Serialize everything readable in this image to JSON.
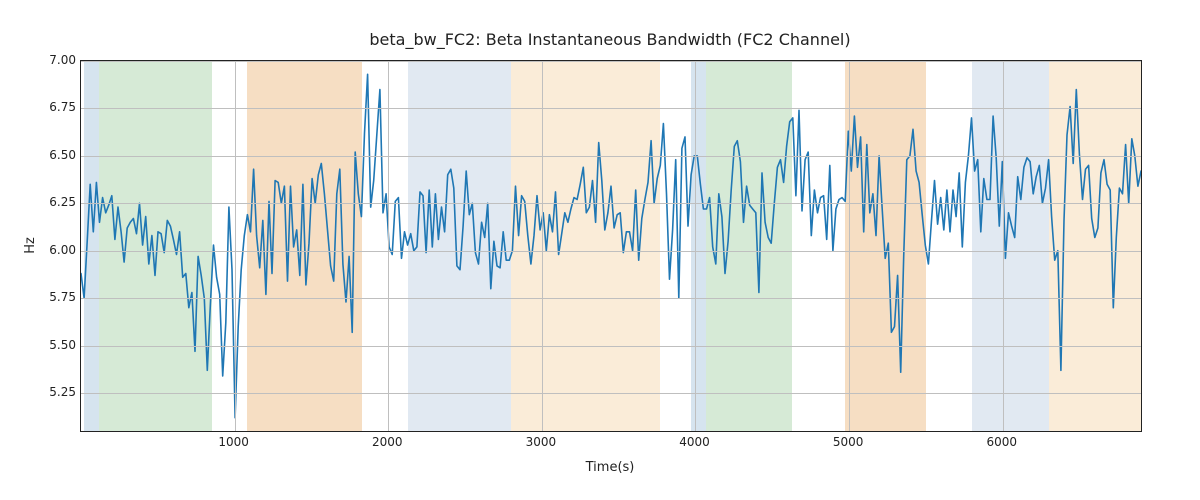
{
  "chart_data": {
    "type": "line",
    "title": "beta_bw_FC2: Beta Instantaneous Bandwidth (FC2 Channel)",
    "xlabel": "Time(s)",
    "ylabel": "Hz",
    "xlim": [
      0,
      6900
    ],
    "ylim": [
      5.05,
      7.0
    ],
    "xticks": [
      1000,
      2000,
      3000,
      4000,
      5000,
      6000
    ],
    "yticks": [
      5.25,
      5.5,
      5.75,
      6.0,
      6.25,
      6.5,
      6.75,
      7.0
    ],
    "spans": [
      {
        "x0": 20,
        "x1": 120,
        "color": "#d6e4ef"
      },
      {
        "x0": 120,
        "x1": 850,
        "color": "#d6ead6"
      },
      {
        "x0": 1080,
        "x1": 1830,
        "color": "#f6dec3"
      },
      {
        "x0": 2130,
        "x1": 2800,
        "color": "#e1e9f2"
      },
      {
        "x0": 2800,
        "x1": 3770,
        "color": "#faecd8"
      },
      {
        "x0": 3970,
        "x1": 4070,
        "color": "#d6e4ef"
      },
      {
        "x0": 4070,
        "x1": 4630,
        "color": "#d6ead6"
      },
      {
        "x0": 4970,
        "x1": 5500,
        "color": "#f6dec3"
      },
      {
        "x0": 5800,
        "x1": 6300,
        "color": "#e1e9f2"
      },
      {
        "x0": 6300,
        "x1": 6900,
        "color": "#faecd8"
      }
    ],
    "series": [
      {
        "name": "beta_bw_FC2",
        "color": "#1f77b4",
        "x_step_hint": "approx 20s per sample",
        "values": [
          5.88,
          5.75,
          6.05,
          6.35,
          6.1,
          6.36,
          6.15,
          6.28,
          6.2,
          6.24,
          6.29,
          6.06,
          6.23,
          6.1,
          5.94,
          6.12,
          6.15,
          6.17,
          6.09,
          6.25,
          6.03,
          6.18,
          5.93,
          6.08,
          5.87,
          6.1,
          6.09,
          5.99,
          6.16,
          6.13,
          6.06,
          5.98,
          6.1,
          5.86,
          5.88,
          5.7,
          5.78,
          5.47,
          5.97,
          5.87,
          5.75,
          5.37,
          5.72,
          6.03,
          5.86,
          5.77,
          5.34,
          5.62,
          6.23,
          5.9,
          5.12,
          5.6,
          5.9,
          6.08,
          6.19,
          6.1,
          6.43,
          6.08,
          5.91,
          6.16,
          5.77,
          6.26,
          5.88,
          6.37,
          6.36,
          6.25,
          6.34,
          5.84,
          6.34,
          6.02,
          6.11,
          5.87,
          6.35,
          5.82,
          6.04,
          6.38,
          6.25,
          6.4,
          6.46,
          6.3,
          6.11,
          5.92,
          5.84,
          6.3,
          6.43,
          5.93,
          5.73,
          5.97,
          5.57,
          6.52,
          6.3,
          6.18,
          6.62,
          6.93,
          6.23,
          6.37,
          6.61,
          6.85,
          6.2,
          6.3,
          6.02,
          5.98,
          6.26,
          6.28,
          5.96,
          6.1,
          6.03,
          6.09,
          6.0,
          6.02,
          6.31,
          6.29,
          5.99,
          6.32,
          6.02,
          6.3,
          6.06,
          6.23,
          6.1,
          6.4,
          6.43,
          6.33,
          5.92,
          5.9,
          6.13,
          6.42,
          6.19,
          6.25,
          5.99,
          5.93,
          6.15,
          6.07,
          6.25,
          5.8,
          6.05,
          5.92,
          5.91,
          6.1,
          5.95,
          5.95,
          6.0,
          6.34,
          6.08,
          6.29,
          6.26,
          6.08,
          5.93,
          6.08,
          6.29,
          6.11,
          6.2,
          6.0,
          6.19,
          6.1,
          6.31,
          5.98,
          6.09,
          6.2,
          6.15,
          6.22,
          6.28,
          6.27,
          6.35,
          6.44,
          6.2,
          6.23,
          6.37,
          6.15,
          6.57,
          6.37,
          6.11,
          6.2,
          6.34,
          6.12,
          6.19,
          6.2,
          5.99,
          6.1,
          6.1,
          6.0,
          6.32,
          5.95,
          6.17,
          6.27,
          6.36,
          6.58,
          6.25,
          6.38,
          6.45,
          6.67,
          6.3,
          5.85,
          6.11,
          6.48,
          5.75,
          6.54,
          6.6,
          6.13,
          6.4,
          6.5,
          6.5,
          6.35,
          6.22,
          6.22,
          6.28,
          6.02,
          5.93,
          6.3,
          6.18,
          5.88,
          6.05,
          6.32,
          6.55,
          6.58,
          6.47,
          6.15,
          6.34,
          6.24,
          6.22,
          6.2,
          5.78,
          6.41,
          6.15,
          6.07,
          6.04,
          6.25,
          6.44,
          6.48,
          6.36,
          6.55,
          6.68,
          6.7,
          6.29,
          6.74,
          6.21,
          6.48,
          6.52,
          6.08,
          6.32,
          6.2,
          6.28,
          6.29,
          6.06,
          6.45,
          6.0,
          6.22,
          6.27,
          6.28,
          6.26,
          6.63,
          6.42,
          6.71,
          6.44,
          6.6,
          6.1,
          6.56,
          6.2,
          6.3,
          6.08,
          6.5,
          6.22,
          5.96,
          6.04,
          5.57,
          5.6,
          5.87,
          5.36,
          5.97,
          6.48,
          6.5,
          6.64,
          6.42,
          6.36,
          6.19,
          6.03,
          5.93,
          6.16,
          6.37,
          6.14,
          6.28,
          6.11,
          6.32,
          6.1,
          6.32,
          6.18,
          6.41,
          6.02,
          6.36,
          6.5,
          6.7,
          6.42,
          6.48,
          6.1,
          6.38,
          6.27,
          6.27,
          6.71,
          6.49,
          6.13,
          6.47,
          5.96,
          6.2,
          6.13,
          6.07,
          6.39,
          6.27,
          6.44,
          6.49,
          6.47,
          6.3,
          6.39,
          6.45,
          6.25,
          6.33,
          6.48,
          6.18,
          5.95,
          6.0,
          5.37,
          6.16,
          6.61,
          6.76,
          6.46,
          6.85,
          6.51,
          6.27,
          6.43,
          6.45,
          6.17,
          6.07,
          6.12,
          6.41,
          6.48,
          6.35,
          6.32,
          5.7,
          6.07,
          6.33,
          6.3,
          6.56,
          6.25,
          6.59,
          6.5,
          6.34,
          6.42
        ]
      }
    ]
  }
}
